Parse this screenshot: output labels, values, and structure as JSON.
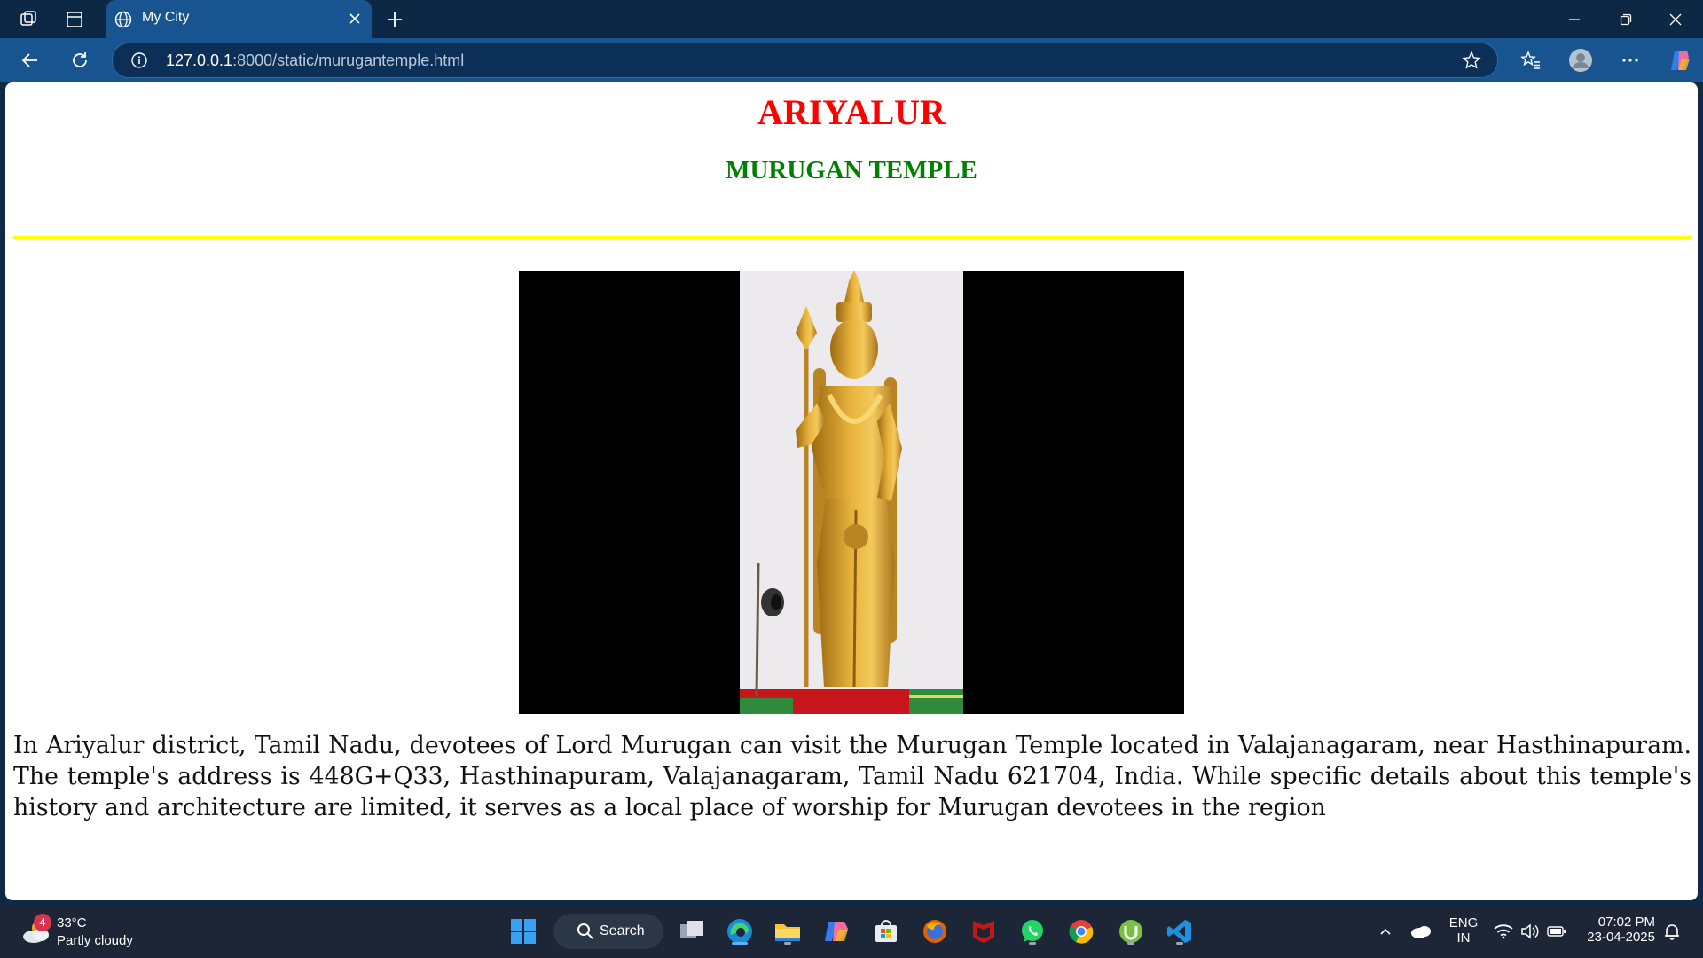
{
  "browser": {
    "tab_title": "My City",
    "url_host": "127.0.0.1",
    "url_path": ":8000/static/murugantemple.html"
  },
  "page": {
    "title": "ARIYALUR",
    "subtitle": "MURUGAN TEMPLE",
    "image_subject": "golden Lord Murugan statue",
    "paragraph": "In Ariyalur district, Tamil Nadu, devotees of Lord Murugan can visit the Murugan Temple located in Valajanagaram, near Hasthinapuram. The temple's address is 448G+Q33, Hasthinapuram, Valajanagaram, Tamil Nadu 621704, India. While specific details about this temple's history and architecture are limited, it serves as a local place of worship for Murugan devotees in the region",
    "colors": {
      "title": "#ff0000",
      "subtitle": "#008000",
      "rule": "#ffff00"
    }
  },
  "taskbar": {
    "weather_badge": "4",
    "weather_temp": "33°C",
    "weather_condition": "Partly cloudy",
    "search_label": "Search",
    "language_top": "ENG",
    "language_bottom": "IN",
    "time": "07:02 PM",
    "date": "23-04-2025",
    "pinned_apps": [
      "task-view-icon",
      "edge-icon",
      "file-explorer-icon",
      "copilot-icon",
      "microsoft-store-icon",
      "firefox-icon",
      "mcafee-icon",
      "whatsapp-icon",
      "chrome-icon",
      "utorrent-icon",
      "vscode-icon"
    ]
  }
}
